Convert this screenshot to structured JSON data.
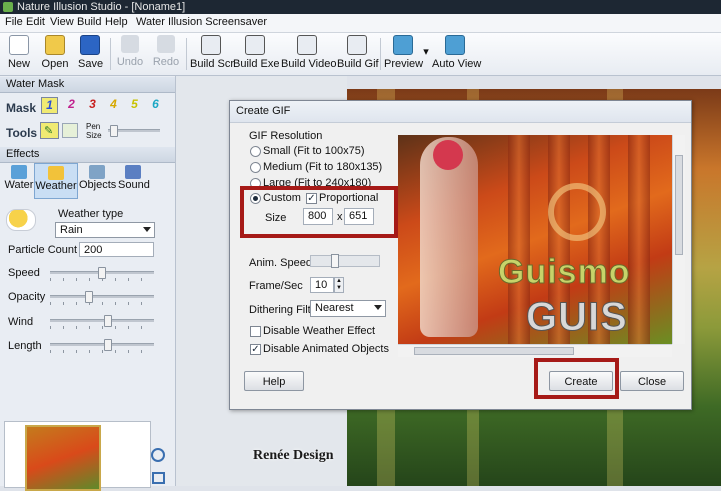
{
  "window": {
    "title": "Nature Illusion Studio - [Noname1]"
  },
  "menu": [
    "File",
    "Edit",
    "View",
    "Build",
    "Help",
    "Water Illusion Screensaver"
  ],
  "toolbar": {
    "new": "New",
    "open": "Open",
    "save": "Save",
    "undo": "Undo",
    "redo": "Redo",
    "build_scr": "Build Scr",
    "build_exe": "Build Exe",
    "build_video": "Build Video",
    "build_gif": "Build Gif",
    "preview": "Preview",
    "auto_view": "Auto View"
  },
  "left_panel": {
    "water_mask_title": "Water Mask",
    "mask_label": "Mask",
    "mask_buttons": [
      "1",
      "2",
      "3",
      "4",
      "5",
      "6"
    ],
    "tools_label": "Tools",
    "pen_size_label": "Pen Size",
    "effects_title": "Effects",
    "effect_tabs": [
      "Water",
      "Weather",
      "Objects",
      "Sound"
    ],
    "weather_type_label": "Weather type",
    "weather_type_value": "Rain",
    "particle_count_label": "Particle Count",
    "particle_count_value": "200",
    "speed_label": "Speed",
    "opacity_label": "Opacity",
    "wind_label": "Wind",
    "length_label": "Length"
  },
  "dialog": {
    "title": "Create GIF",
    "gif_resolution_label": "GIF Resolution",
    "res_small": "Small (Fit to 100x75)",
    "res_medium": "Medium (Fit to 180x135)",
    "res_large": "Large (Fit to 240x180)",
    "custom_label": "Custom",
    "proportional_label": "Proportional",
    "size_label": "Size",
    "width_value": "800",
    "x_label": "x",
    "height_value": "651",
    "anim_speed_label": "Anim. Speed",
    "frame_sec_label": "Frame/Sec",
    "frame_sec_value": "10",
    "dithering_label": "Dithering Filter",
    "dithering_value": "Nearest",
    "disable_weather_label": "Disable Weather Effect",
    "disable_animated_label": "Disable Animated Objects",
    "help_button": "Help",
    "create_button": "Create",
    "close_button": "Close",
    "preview_text_1": "Guismo",
    "preview_text_2": "GUIS"
  },
  "watermark": "Renée Design",
  "colors": {
    "highlight_red": "#a61a17",
    "mask_colors": [
      "#2a4fd8",
      "#c0228e",
      "#c82020",
      "#d6a800",
      "#c8c200",
      "#1aa7c4"
    ]
  }
}
